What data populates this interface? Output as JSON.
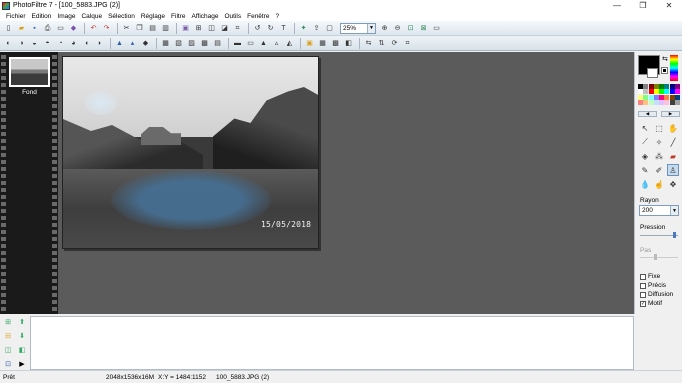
{
  "window": {
    "title": "PhotoFiltre 7 - [100_5883.JPG (2)]",
    "minimize": "—",
    "maximize": "❐",
    "close": "✕"
  },
  "menu": [
    "Fichier",
    "Edition",
    "Image",
    "Calque",
    "Sélection",
    "Réglage",
    "Filtre",
    "Affichage",
    "Outils",
    "Fenêtre",
    "?"
  ],
  "toolbar": {
    "zoom_value": "25%"
  },
  "layers": {
    "items": [
      {
        "label": "Fond"
      }
    ]
  },
  "document": {
    "date_stamp": "15/05/2018"
  },
  "tool_options": {
    "rayon_label": "Rayon",
    "rayon_value": "200",
    "pression_label": "Pression",
    "pression_level": 0.95,
    "pas_label": "Pas",
    "pas_level": 0.4,
    "checkboxes": [
      {
        "label": "Fixe",
        "checked": false
      },
      {
        "label": "Précis",
        "checked": false
      },
      {
        "label": "Diffusion",
        "checked": false
      },
      {
        "label": "Motif",
        "checked": true
      }
    ]
  },
  "colors": {
    "foreground": "#000000",
    "background": "#ffffff",
    "workspace": "#5b5b5b"
  },
  "palette": [
    "#000000",
    "#808080",
    "#800000",
    "#808000",
    "#008000",
    "#008080",
    "#000080",
    "#800080",
    "#ffffff",
    "#c0c0c0",
    "#ff0000",
    "#ffff00",
    "#00ff00",
    "#00ffff",
    "#0000ff",
    "#ff00ff",
    "#ffff80",
    "#80ff80",
    "#80ffff",
    "#8080ff",
    "#ff0080",
    "#ff8040",
    "#804000",
    "#004080",
    "#ff8080",
    "#ffc080",
    "#c0ffc0",
    "#c0e0ff",
    "#e0c0ff",
    "#ffc0e0",
    "#404040",
    "#a0a0a0"
  ],
  "status": {
    "ready": "Prêt",
    "image_size": "2048x1536x16M",
    "coords": "X:Y = 1484:1152",
    "filename": "100_5883.JPG (2)"
  }
}
